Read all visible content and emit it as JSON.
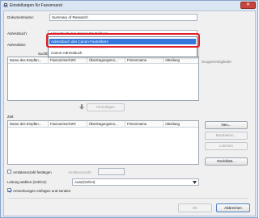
{
  "window": {
    "title": "Einstellungen für Faxversand",
    "close_glyph": "✕"
  },
  "document": {
    "label": "Dokumentname:",
    "value": "Summary of Research"
  },
  "address_book": {
    "label": "Adressbuch:",
    "selected_value": "Adressbuch des Canon-Faxtreibers",
    "options": [
      "Adressbuch des Canon-Faxtreibers",
      "Adressbuch des Canon-Faxtreibers",
      "Canon-Adressbuch"
    ]
  },
  "recipients": {
    "label": "Adressliste:",
    "search_label": "Suchbegriff:",
    "group_members_label": "Gruppenmitglieder"
  },
  "columns": [
    "Name des Empfän...",
    "Faxnummer/URI",
    "Übertragungsmo...",
    "Firmenname",
    "Abteilung"
  ],
  "buttons": {
    "add": "Hinzufügen",
    "new": "Neu...",
    "edit": "Bearbeiten...",
    "delete": "Löschen",
    "cover_sheet": "Deckblatt...",
    "ok": "OK",
    "cancel": "Abbrechen"
  },
  "target": {
    "label": "Ziel:"
  },
  "outside_line": {
    "checkbox_label": "Amtskennzahl festlegen",
    "number_label": "Amtskennzahl:",
    "value": ""
  },
  "line_select": {
    "label": "Leitung wählen (G3/G4):",
    "value": "Auto(G3/G4)"
  },
  "save_checkbox": {
    "label": "Anmerkungen einfügen und senden",
    "checked": true
  }
}
